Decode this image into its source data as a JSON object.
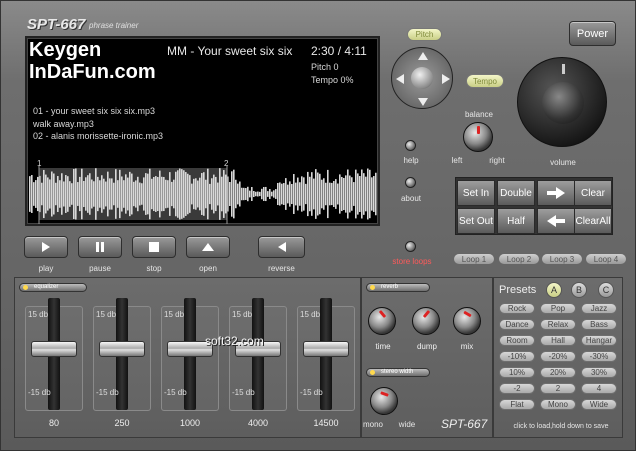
{
  "app": {
    "title": "SPT-667",
    "subtitle": "phrase trainer",
    "footer_brand": "SPT-667"
  },
  "watermark": {
    "line1": "Keygen",
    "line2": "InDaFun.com",
    "overlay": "soft32.com"
  },
  "display": {
    "track_title": "MM  -  Your sweet six six",
    "time": "2:30 / 4:11",
    "pitch": "Pitch 0",
    "tempo": "Tempo 0%",
    "playlist": [
      "01 - your sweet six six six.mp3",
      "walk away.mp3",
      "02 - alanis morissette-ironic.mp3"
    ],
    "marker1": "1",
    "marker2": "2"
  },
  "transport": {
    "play": "play",
    "pause": "pause",
    "stop": "stop",
    "open": "open",
    "reverse": "reverse"
  },
  "side": {
    "help": "help",
    "about": "about",
    "store_loops": "store loops"
  },
  "pitch_pad": {
    "pitch": "Pitch",
    "tempo": "Tempo"
  },
  "balance": {
    "label": "balance",
    "left": "left",
    "right": "right"
  },
  "power": "Power",
  "volume": "volume",
  "loop_grid": {
    "set_in": "Set In",
    "double": "Double",
    "clear": "Clear",
    "set_out": "Set Out",
    "half": "Half",
    "clear_all": "ClearAll"
  },
  "loops": [
    "Loop 1",
    "Loop 2",
    "Loop 3",
    "Loop 4"
  ],
  "equalizer": {
    "header": "equalizer",
    "top_db": "15 db",
    "bottom_db": "-15 db",
    "bands": [
      "80",
      "250",
      "1000",
      "4000",
      "14500"
    ],
    "levels": [
      0,
      0,
      0,
      0,
      0
    ]
  },
  "reverb": {
    "header": "reverb",
    "time": "time",
    "dump": "dump",
    "mix": "mix"
  },
  "stereo": {
    "header": "stereo width",
    "mono": "mono",
    "wide": "wide"
  },
  "presets": {
    "title": "Presets",
    "slots": [
      "A",
      "B",
      "C"
    ],
    "selected": "A",
    "buttons": [
      [
        "Rock",
        "Pop",
        "Jazz"
      ],
      [
        "Dance",
        "Relax",
        "Bass"
      ],
      [
        "Room",
        "Hall",
        "Hangar"
      ],
      [
        "-10%",
        "-20%",
        "-30%"
      ],
      [
        "10%",
        "20%",
        "30%"
      ],
      [
        "-2",
        "2",
        "4"
      ],
      [
        "Flat",
        "Mono",
        "Wide"
      ]
    ],
    "hint": "click to load,hold down to save"
  },
  "colors": {
    "accent_green": "#c9cf86",
    "knob_mark": "#dd2222"
  }
}
